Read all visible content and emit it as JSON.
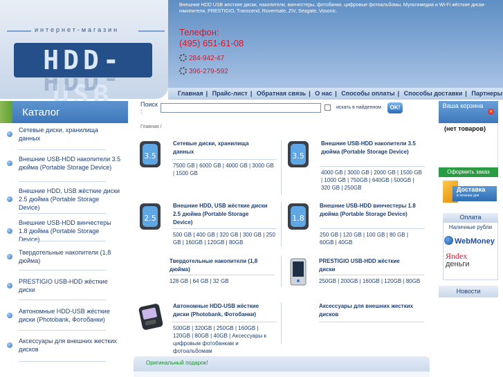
{
  "header": {
    "logo_tagline": "интернет-магазин",
    "logo_text": "HDD-USB",
    "description": "Внешние HDD USB жесткие диски, накопители, винчестеры, фотобанки, цифровые фотоальбомы, Мультимедиа и Wi-Fi жёсткие диски-накопители, PRESTIGIO, Transcend, Rovermate, ZIV, Seagate, Vosonic.",
    "phone_label": "Телефон:",
    "phone_number": "(495) 651-61-08",
    "icq_1": "284-942-47",
    "icq_2": "396-279-592"
  },
  "nav": {
    "items": [
      "Главная",
      "Прайс-лист",
      "Обратная связь",
      "О нас",
      "Способы оплаты",
      "Способы доставки",
      "Партнеры"
    ]
  },
  "catalog": {
    "title": "Каталог",
    "items": [
      "Сетевые диски, хранилища данных",
      "Внешние USB-HDD накопители 3.5 дюйма (Portable Storage Device)",
      "Внешние HDD, USB жёсткие диски 2.5 дюйма (Portable Storage Device)",
      "Внешние USB-HDD винчестеры 1.8 дюйма (Portable Storage Device)",
      "Твердотельные накопители (1,8 дюйма)",
      "PRESTIGIO USB-HDD жёсткие диски",
      "Автономные HDD-USB жёсткие диски (Photobank, Фотобанки)",
      "Аксессуары для внешних жестких дисков"
    ]
  },
  "search": {
    "label": "Поиск :",
    "placeholder": "",
    "checkbox_label": "искать в найденном",
    "button": "OK!"
  },
  "breadcrumb": "Главная /",
  "products": [
    {
      "title": "Сетевые диски, хранилища данных",
      "capacities": "7500 GB | 6000 GB | 4000 GB | 3000 GB | 1500 GB",
      "badge": "3.5"
    },
    {
      "title": "Внешние USB-HDD накопители 3.5 дюйма (Portable Storage Device)",
      "capacities": "4000 GB | 3000 GB | 2000 GB | 1500 GB | 1000 GB | 750GB | 640GB | 500GB | 320 GB | 250GB",
      "badge": "3.5"
    },
    {
      "title": "Внешние HDD, USB жёсткие диски 2.5 дюйма (Portable Storage Device)",
      "capacities": "500 GB | 400 GB | 320 GB | 300 GB | 250 GB | 160GB | 120GB | 80GB",
      "badge": "2.5"
    },
    {
      "title": "Внешние USB-HDD винчестеры 1.8 дюйма (Portable Storage Device)",
      "capacities": "250 GB | 120 GB | 100 GB | 80 GB | 60GB | 40GB",
      "badge": "1.8"
    },
    {
      "title": "Твердотельные накопители (1,8 дюйма)",
      "capacities": "128 GB | 64 GB | 32 GB",
      "badge": ""
    },
    {
      "title": "PRESTIGIO USB-HDD жёсткие диски",
      "capacities": "250GB | 200GB | 160GB | 120GB | 80GB",
      "badge": ""
    },
    {
      "title": "Автономные HDD-USB жёсткие диски (Photobank, Фотобанки)",
      "capacities": "500GB | 320GB | 250GB | 160GB | 120GB | 80GB | 40GB | Аксессуары к цифровым фотобанкам и фотоальбомам",
      "badge": ""
    },
    {
      "title": "Аксессуары для внешних жестких дисков",
      "capacities": "",
      "badge": ""
    }
  ],
  "gift": {
    "label": "Оригинальный подарок!"
  },
  "cart": {
    "title": "Ваша корзина",
    "empty": "(нет товаров)",
    "order_button": "Оформить заказ"
  },
  "delivery_banner": {
    "title": "Доставка",
    "subtitle": "в течение дня"
  },
  "payment": {
    "title": "Оплата",
    "subtitle": "Наличные рубли",
    "webmoney": "WebMoney",
    "yandex": "Яndex",
    "yandex_money": "деньги"
  },
  "news": {
    "title": "Новости"
  },
  "colors": {
    "accent": "#3e78bb",
    "phone": "#d4172b",
    "order": "#2a9a43"
  }
}
